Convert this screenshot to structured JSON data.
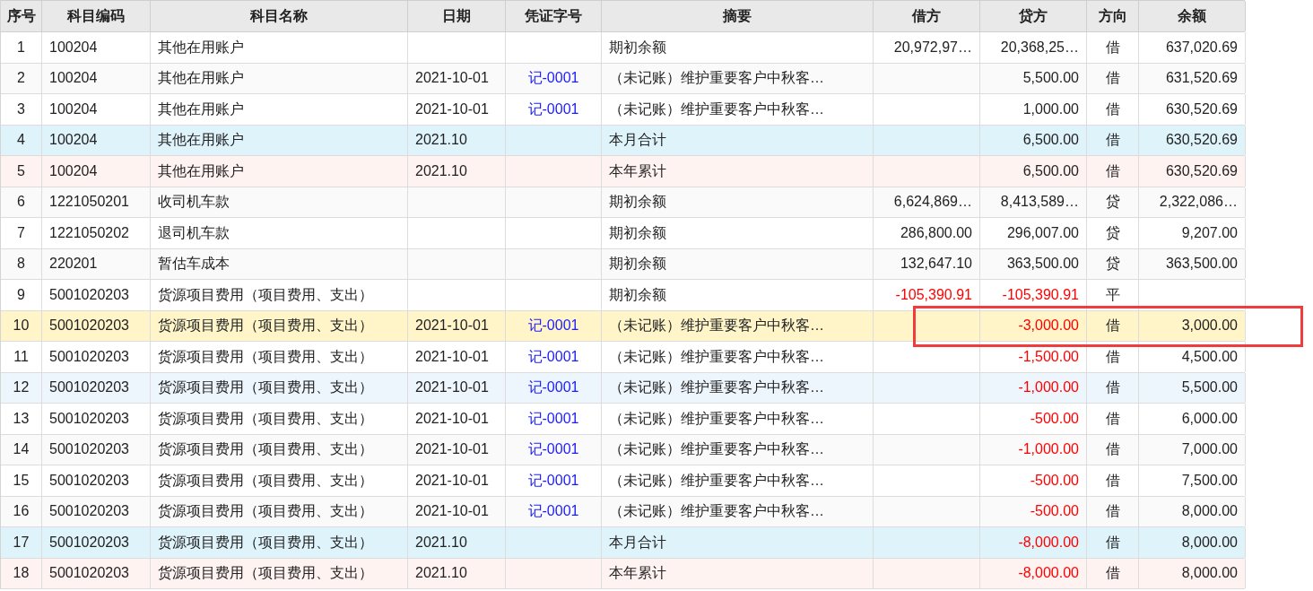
{
  "table": {
    "columns": [
      "序号",
      "科目编码",
      "科目名称",
      "日期",
      "凭证字号",
      "摘要",
      "借方",
      "贷方",
      "方向",
      "余额"
    ],
    "rows": [
      {
        "kind": "entry",
        "no": "1",
        "code": "100204",
        "name": "其他在用账户",
        "date": "",
        "voucher": "",
        "summary": "期初余额",
        "debit": "20,972,97…",
        "credit": "20,368,25…",
        "direction": "借",
        "balance": "637,020.69",
        "amounts_red": false,
        "selected": false,
        "hovered": false,
        "marked": false
      },
      {
        "kind": "entry",
        "no": "2",
        "code": "100204",
        "name": "其他在用账户",
        "date": "2021-10-01",
        "voucher": "记-0001",
        "summary": "（未记账）维护重要客户中秋客…",
        "debit": "",
        "credit": "5,500.00",
        "direction": "借",
        "balance": "631,520.69",
        "amounts_red": false,
        "selected": false,
        "hovered": false,
        "marked": false
      },
      {
        "kind": "entry",
        "no": "3",
        "code": "100204",
        "name": "其他在用账户",
        "date": "2021-10-01",
        "voucher": "记-0001",
        "summary": "（未记账）维护重要客户中秋客…",
        "debit": "",
        "credit": "1,000.00",
        "direction": "借",
        "balance": "630,520.69",
        "amounts_red": false,
        "selected": false,
        "hovered": false,
        "marked": false
      },
      {
        "kind": "month_total",
        "no": "4",
        "code": "100204",
        "name": "其他在用账户",
        "date": "2021.10",
        "voucher": "",
        "summary": "本月合计",
        "debit": "",
        "credit": "6,500.00",
        "direction": "借",
        "balance": "630,520.69",
        "amounts_red": false,
        "selected": false,
        "hovered": false,
        "marked": false
      },
      {
        "kind": "year_total",
        "no": "5",
        "code": "100204",
        "name": "其他在用账户",
        "date": "2021.10",
        "voucher": "",
        "summary": "本年累计",
        "debit": "",
        "credit": "6,500.00",
        "direction": "借",
        "balance": "630,520.69",
        "amounts_red": false,
        "selected": false,
        "hovered": false,
        "marked": false
      },
      {
        "kind": "entry",
        "no": "6",
        "code": "1221050201",
        "name": "收司机车款",
        "date": "",
        "voucher": "",
        "summary": "期初余额",
        "debit": "6,624,869…",
        "credit": "8,413,589…",
        "direction": "贷",
        "balance": "2,322,086…",
        "amounts_red": false,
        "selected": false,
        "hovered": false,
        "marked": false
      },
      {
        "kind": "entry",
        "no": "7",
        "code": "1221050202",
        "name": "退司机车款",
        "date": "",
        "voucher": "",
        "summary": "期初余额",
        "debit": "286,800.00",
        "credit": "296,007.00",
        "direction": "贷",
        "balance": "9,207.00",
        "amounts_red": false,
        "selected": false,
        "hovered": false,
        "marked": false
      },
      {
        "kind": "entry",
        "no": "8",
        "code": "220201",
        "name": "暂估车成本",
        "date": "",
        "voucher": "",
        "summary": "期初余额",
        "debit": "132,647.10",
        "credit": "363,500.00",
        "direction": "贷",
        "balance": "363,500.00",
        "amounts_red": false,
        "selected": false,
        "hovered": false,
        "marked": false
      },
      {
        "kind": "entry",
        "no": "9",
        "code": "5001020203",
        "name": "货源项目费用（项目费用、支出）",
        "date": "",
        "voucher": "",
        "summary": "期初余额",
        "debit": "-105,390.91",
        "credit": "-105,390.91",
        "direction": "平",
        "balance": "",
        "amounts_red": true,
        "selected": false,
        "hovered": false,
        "marked": false
      },
      {
        "kind": "entry",
        "no": "10",
        "code": "5001020203",
        "name": "货源项目费用（项目费用、支出）",
        "date": "2021-10-01",
        "voucher": "记-0001",
        "summary": "（未记账）维护重要客户中秋客…",
        "debit": "",
        "credit": "-3,000.00",
        "direction": "借",
        "balance": "3,000.00",
        "amounts_red": true,
        "selected": true,
        "hovered": false,
        "marked": true
      },
      {
        "kind": "entry",
        "no": "11",
        "code": "5001020203",
        "name": "货源项目费用（项目费用、支出）",
        "date": "2021-10-01",
        "voucher": "记-0001",
        "summary": "（未记账）维护重要客户中秋客…",
        "debit": "",
        "credit": "-1,500.00",
        "direction": "借",
        "balance": "4,500.00",
        "amounts_red": true,
        "selected": false,
        "hovered": false,
        "marked": false
      },
      {
        "kind": "entry",
        "no": "12",
        "code": "5001020203",
        "name": "货源项目费用（项目费用、支出）",
        "date": "2021-10-01",
        "voucher": "记-0001",
        "summary": "（未记账）维护重要客户中秋客…",
        "debit": "",
        "credit": "-1,000.00",
        "direction": "借",
        "balance": "5,500.00",
        "amounts_red": true,
        "selected": false,
        "hovered": true,
        "marked": false
      },
      {
        "kind": "entry",
        "no": "13",
        "code": "5001020203",
        "name": "货源项目费用（项目费用、支出）",
        "date": "2021-10-01",
        "voucher": "记-0001",
        "summary": "（未记账）维护重要客户中秋客…",
        "debit": "",
        "credit": "-500.00",
        "direction": "借",
        "balance": "6,000.00",
        "amounts_red": true,
        "selected": false,
        "hovered": false,
        "marked": false
      },
      {
        "kind": "entry",
        "no": "14",
        "code": "5001020203",
        "name": "货源项目费用（项目费用、支出）",
        "date": "2021-10-01",
        "voucher": "记-0001",
        "summary": "（未记账）维护重要客户中秋客…",
        "debit": "",
        "credit": "-1,000.00",
        "direction": "借",
        "balance": "7,000.00",
        "amounts_red": true,
        "selected": false,
        "hovered": false,
        "marked": false
      },
      {
        "kind": "entry",
        "no": "15",
        "code": "5001020203",
        "name": "货源项目费用（项目费用、支出）",
        "date": "2021-10-01",
        "voucher": "记-0001",
        "summary": "（未记账）维护重要客户中秋客…",
        "debit": "",
        "credit": "-500.00",
        "direction": "借",
        "balance": "7,500.00",
        "amounts_red": true,
        "selected": false,
        "hovered": false,
        "marked": false
      },
      {
        "kind": "entry",
        "no": "16",
        "code": "5001020203",
        "name": "货源项目费用（项目费用、支出）",
        "date": "2021-10-01",
        "voucher": "记-0001",
        "summary": "（未记账）维护重要客户中秋客…",
        "debit": "",
        "credit": "-500.00",
        "direction": "借",
        "balance": "8,000.00",
        "amounts_red": true,
        "selected": false,
        "hovered": false,
        "marked": false
      },
      {
        "kind": "month_total",
        "no": "17",
        "code": "5001020203",
        "name": "货源项目费用（项目费用、支出）",
        "date": "2021.10",
        "voucher": "",
        "summary": "本月合计",
        "debit": "",
        "credit": "-8,000.00",
        "direction": "借",
        "balance": "8,000.00",
        "amounts_red": true,
        "selected": false,
        "hovered": false,
        "marked": false
      },
      {
        "kind": "year_total",
        "no": "18",
        "code": "5001020203",
        "name": "货源项目费用（项目费用、支出）",
        "date": "2021.10",
        "voucher": "",
        "summary": "本年累计",
        "debit": "",
        "credit": "-8,000.00",
        "direction": "借",
        "balance": "8,000.00",
        "amounts_red": true,
        "selected": false,
        "hovered": false,
        "marked": false
      }
    ]
  }
}
